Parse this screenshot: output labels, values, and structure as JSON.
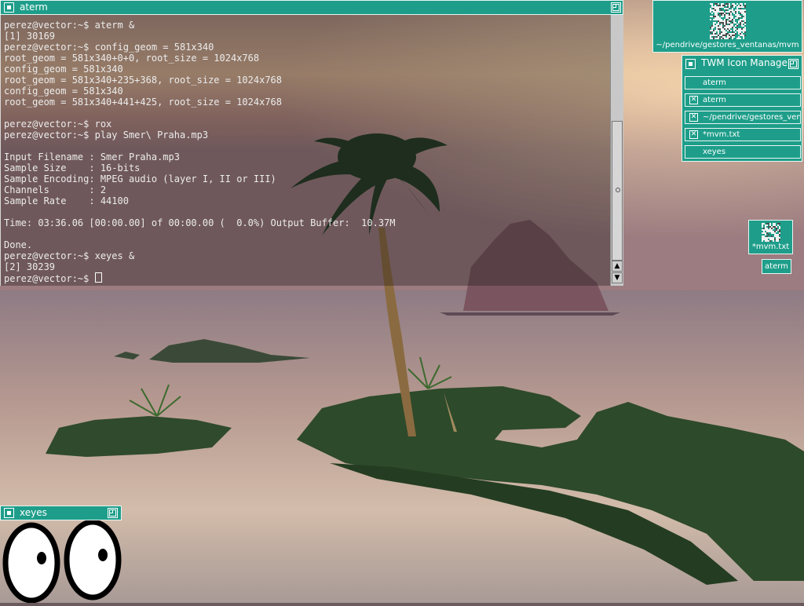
{
  "colors": {
    "frame": "#1e9e8a",
    "frame_border": "#e8f5f2",
    "terminal_text": "#ececec"
  },
  "aterm": {
    "title": "aterm",
    "lines": [
      "perez@vector:~$ aterm &",
      "[1] 30169",
      "perez@vector:~$ config_geom = 581x340",
      "root_geom = 581x340+0+0, root_size = 1024x768",
      "config_geom = 581x340",
      "root_geom = 581x340+235+368, root_size = 1024x768",
      "config_geom = 581x340",
      "root_geom = 581x340+441+425, root_size = 1024x768",
      "",
      "perez@vector:~$ rox",
      "perez@vector:~$ play Smer\\ Praha.mp3",
      "",
      "Input Filename : Smer Praha.mp3",
      "Sample Size    : 16-bits",
      "Sample Encoding: MPEG audio (layer I, II or III)",
      "Channels       : 2",
      "Sample Rate    : 44100",
      "",
      "Time: 03:36.06 [00:00.00] of 00:00.00 (  0.0%) Output Buffer:  10.37M",
      "",
      "Done.",
      "perez@vector:~$ xeyes &",
      "[2] 30239"
    ],
    "prompt": "perez@vector:~$ ",
    "scroll_up_icon": "triangle-up-icon",
    "scroll_down_icon": "triangle-down-icon"
  },
  "xeyes": {
    "title": "xeyes"
  },
  "icons": {
    "mvm_dir_label": "~/pendrive/gestores_ventanas/mvm",
    "mvm_txt_label": "*mvm.txt",
    "aterm_label": "aterm"
  },
  "icon_manager": {
    "title": "TWM Icon Manager",
    "items": [
      {
        "label": "aterm",
        "iconified": false
      },
      {
        "label": "aterm",
        "iconified": true
      },
      {
        "label": "~/pendrive/gestores_ven",
        "iconified": true
      },
      {
        "label": "*mvm.txt",
        "iconified": true
      },
      {
        "label": "xeyes",
        "iconified": false
      }
    ]
  }
}
